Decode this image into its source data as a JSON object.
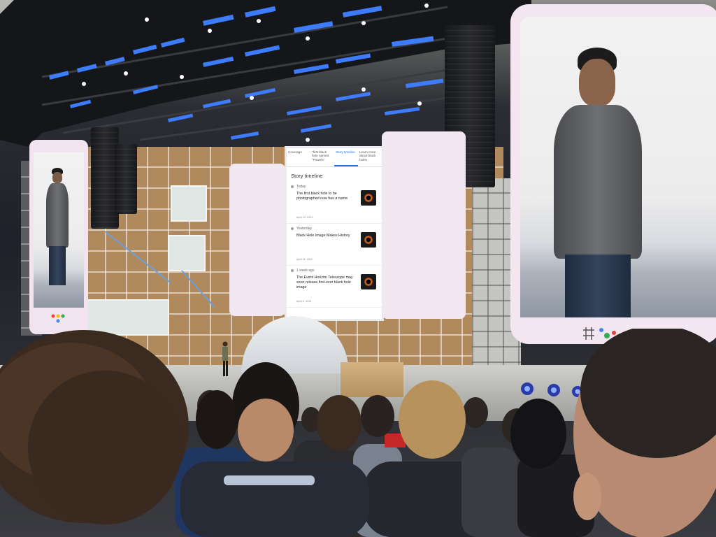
{
  "scene": "keynote-stage",
  "phone_ui": {
    "tabs": [
      {
        "label": "Coverage"
      },
      {
        "label": "\"first black hole named \"Powehi\""
      },
      {
        "label": "Story timeline"
      },
      {
        "label": "Learn more about black holes"
      }
    ],
    "heading": "Story timeline",
    "items": [
      {
        "when": "Today",
        "headline": "The first black hole to be photographed now has a name",
        "source": "April 12, 2019"
      },
      {
        "when": "Yesterday",
        "headline": "Black Hole Image Makes History",
        "source": "April 11, 2019"
      },
      {
        "when": "1 week ago",
        "headline": "The Event Horizon Telescope may soon release first-ever black hole image",
        "source": "April 5, 2019"
      }
    ]
  },
  "colors": {
    "stage_light_blue": "#3d7bff",
    "screen_pink": "#f1e4ee",
    "wood_panels": "#b08a5c"
  },
  "icons": [
    "google-logo-mark",
    "stage-light",
    "speaker-array"
  ]
}
